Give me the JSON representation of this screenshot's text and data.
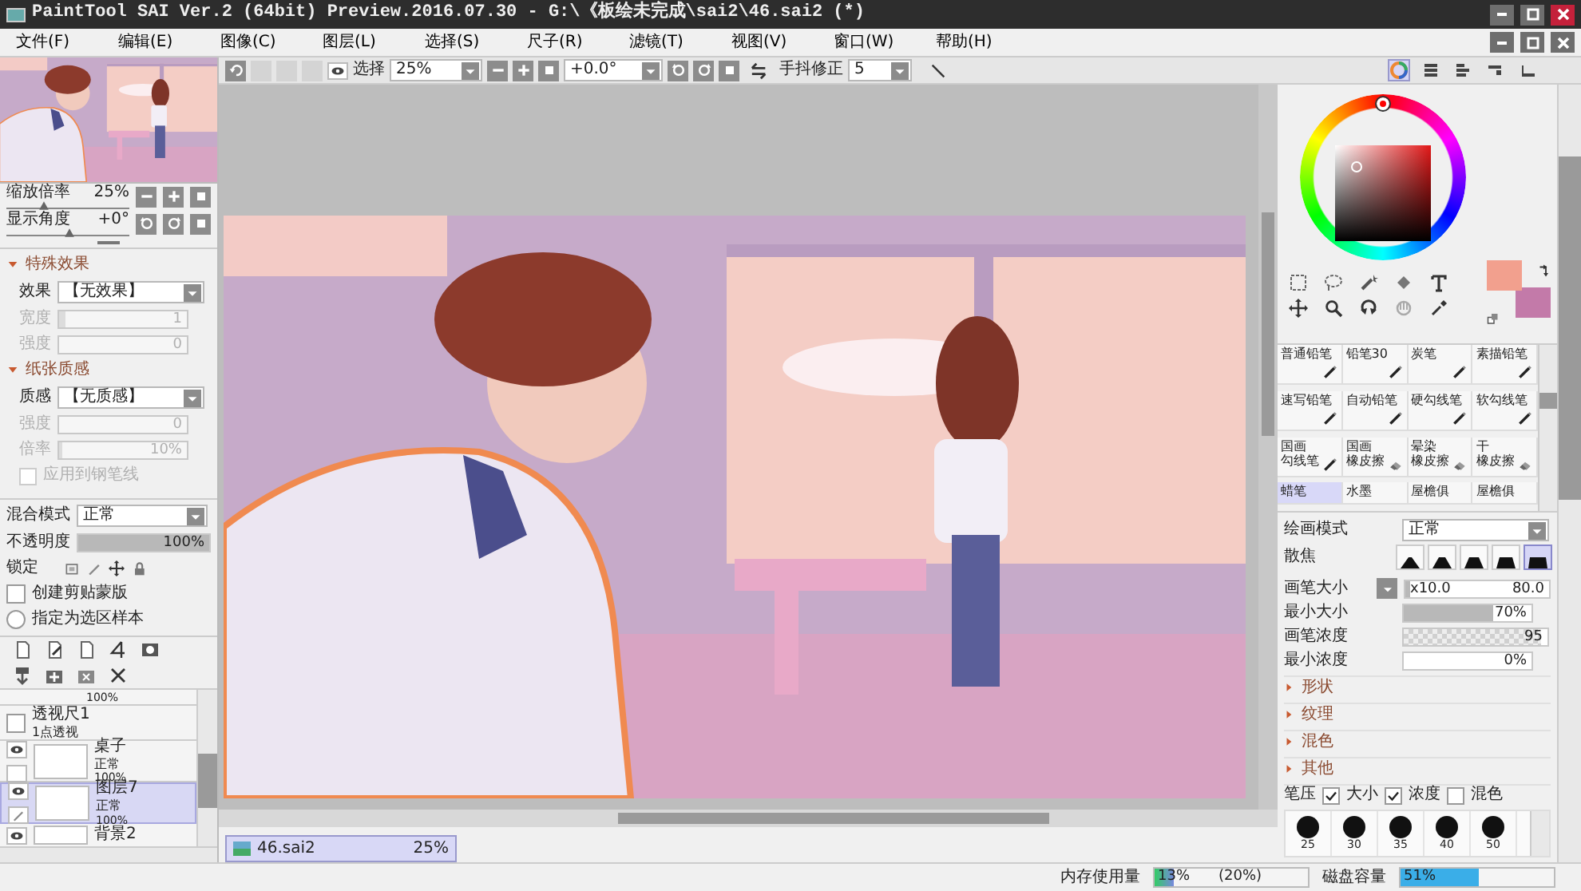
{
  "window": {
    "title": "PaintTool SAI Ver.2 (64bit) Preview.2016.07.30 - G:\\《板绘未完成\\sai2\\46.sai2 (*)"
  },
  "menu": [
    "文件(F)",
    "编辑(E)",
    "图像(C)",
    "图层(L)",
    "选择(S)",
    "尺子(R)",
    "滤镜(T)",
    "视图(V)",
    "窗口(W)",
    "帮助(H)"
  ],
  "toolbar": {
    "selection_label": "选择",
    "selection_visible": true,
    "zoom": "25%",
    "angle": "+0.0°",
    "stabilizer_label": "手抖修正",
    "stabilizer": "5"
  },
  "navigator": {
    "zoom": {
      "label": "缩放倍率",
      "value": "25%",
      "level": 0.3
    },
    "angle": {
      "label": "显示角度",
      "value": "+0°",
      "level": 0.5
    }
  },
  "special_effects": {
    "title": "特殊效果",
    "expanded": true,
    "effect": {
      "label": "效果",
      "value": "【无效果】"
    },
    "params": [
      {
        "label": "宽度",
        "value": "1",
        "disabled": true,
        "level": 0.05
      },
      {
        "label": "强度",
        "value": "0",
        "disabled": true,
        "level": 0
      }
    ]
  },
  "paper_texture": {
    "title": "纸张质感",
    "expanded": true,
    "texture": {
      "label": "质感",
      "value": "【无质感】"
    },
    "params": [
      {
        "label": "强度",
        "value": "0",
        "disabled": true,
        "level": 0
      },
      {
        "label": "倍率",
        "value": "10%",
        "disabled": true,
        "level": 0.03
      }
    ],
    "apply_to_pen": {
      "label": "应用到钢笔线",
      "checked": false,
      "disabled": true
    }
  },
  "layer_properties": {
    "blend": {
      "label": "混合模式",
      "value": "正常"
    },
    "opacity": {
      "label": "不透明度",
      "value": "100%",
      "level": 1
    },
    "lock_label": "锁定",
    "clipping": {
      "label": "创建剪贴蒙版",
      "checked": false
    },
    "selection_source": {
      "label": "指定为选区样本",
      "checked": false
    }
  },
  "layers": [
    {
      "kind": "partial",
      "opacity": "100%",
      "selected": false
    },
    {
      "kind": "ruler",
      "name": "透视尺1",
      "detail": "1点透视",
      "selected": false
    },
    {
      "kind": "layer",
      "name": "桌子",
      "mode": "正常",
      "opacity": "100%",
      "visible": true,
      "selected": false
    },
    {
      "kind": "layer",
      "name": "图层7",
      "mode": "正常",
      "opacity": "100%",
      "visible": true,
      "selected": true
    },
    {
      "kind": "cut",
      "name": "背景2",
      "visible": true,
      "selected": false
    }
  ],
  "document_tabs": [
    {
      "name": "46.sai2",
      "zoom": "25%",
      "selected": true
    }
  ],
  "colors": [
    {
      "kind": "primary",
      "color": "#f2a08e"
    },
    {
      "kind": "secondary",
      "color": "#c37aa9"
    }
  ],
  "brushes": [
    {
      "name": "普通铅笔",
      "kind": "pen",
      "selected": false
    },
    {
      "name": "铅笔30",
      "kind": "pen",
      "selected": false
    },
    {
      "name": "炭笔",
      "kind": "pen",
      "selected": false
    },
    {
      "name": "素描铅笔",
      "kind": "pen",
      "selected": false
    },
    {
      "name": "速写铅笔",
      "kind": "pen",
      "selected": false
    },
    {
      "name": "自动铅笔",
      "kind": "pen",
      "selected": false
    },
    {
      "name": "硬勾线笔",
      "kind": "pen",
      "selected": false
    },
    {
      "name": "软勾线笔",
      "kind": "pen",
      "selected": false
    },
    {
      "name_lines": [
        "国画",
        "勾线笔"
      ],
      "kind": "pen",
      "selected": false
    },
    {
      "name_lines": [
        "国画",
        "橡皮擦"
      ],
      "kind": "eraser",
      "selected": false
    },
    {
      "name_lines": [
        "晕染",
        "橡皮擦"
      ],
      "kind": "eraser",
      "selected": false
    },
    {
      "name_lines": [
        "干",
        "橡皮擦"
      ],
      "kind": "eraser",
      "selected": false
    },
    {
      "name": "蜡笔",
      "kind": "cut",
      "selected": true
    },
    {
      "name": "水墨",
      "kind": "cut",
      "selected": false
    },
    {
      "name": "屋檐俱",
      "kind": "cut",
      "selected": false
    },
    {
      "name": "屋檐俱",
      "kind": "cut",
      "selected": false
    }
  ],
  "brush_settings": {
    "mode": {
      "label": "绘画模式",
      "value": "正常"
    },
    "edge": {
      "label": "散焦",
      "options": [
        {
          "selected": false
        },
        {
          "selected": false
        },
        {
          "selected": false
        },
        {
          "selected": false
        },
        {
          "selected": true
        }
      ]
    },
    "size": {
      "label": "画笔大小",
      "multiplier": "x10.0",
      "value": "80.0",
      "level": 0.03
    },
    "min_size": {
      "label": "最小大小",
      "value": "70%",
      "level": 0.7
    },
    "density": {
      "label": "画笔浓度",
      "value": "95",
      "level": 0.95
    },
    "min_density": {
      "label": "最小浓度",
      "value": "0%",
      "level": 0
    },
    "sections": [
      {
        "title": "形状",
        "expanded": false
      },
      {
        "title": "纹理",
        "expanded": false
      },
      {
        "title": "混色",
        "expanded": false
      },
      {
        "title": "其他",
        "expanded": false
      }
    ],
    "pressure": {
      "label": "笔压",
      "options": [
        {
          "label": "大小",
          "checked": true
        },
        {
          "label": "浓度",
          "checked": true
        },
        {
          "label": "混色",
          "checked": false
        }
      ]
    },
    "presets": [
      "25",
      "30",
      "35",
      "40",
      "50"
    ]
  },
  "status": {
    "memory": {
      "label": "内存使用量",
      "value": "13%",
      "detail": "(20%)",
      "level": 0.13
    },
    "disk": {
      "label": "磁盘容量",
      "value": "51%",
      "level": 0.51
    }
  }
}
